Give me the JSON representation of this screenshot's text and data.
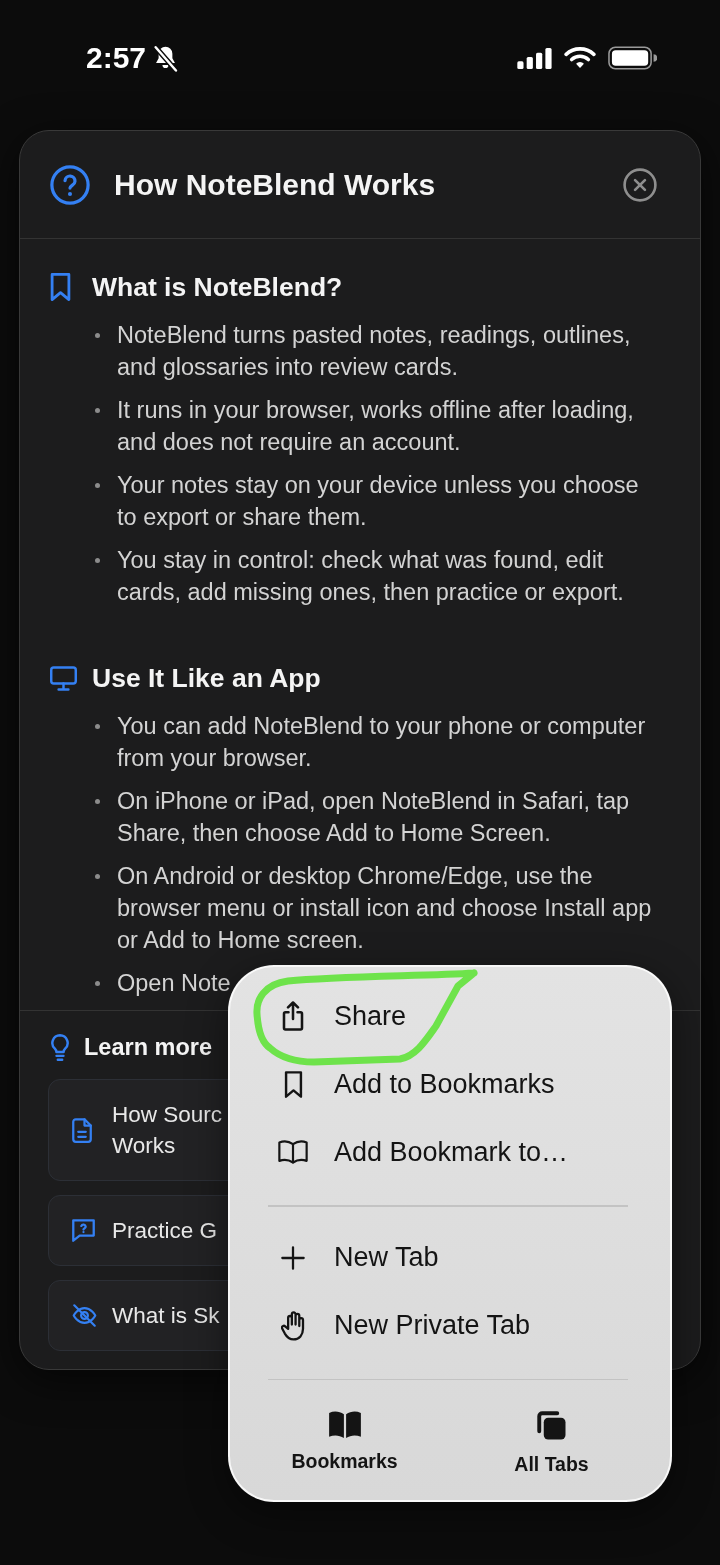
{
  "status_bar": {
    "time": "2:57"
  },
  "dialog": {
    "title": "How NoteBlend Works",
    "sections": [
      {
        "heading": "What is NoteBlend?",
        "bullets": [
          "NoteBlend turns pasted notes, readings, outlines, and glossaries into review cards.",
          "It runs in your browser, works offline after loading, and does not require an account.",
          "Your notes stay on your device unless you choose to export or share them.",
          "You stay in control: check what was found, edit cards, add missing ones, then practice or export."
        ]
      },
      {
        "heading": "Use It Like an App",
        "bullets": [
          "You can add NoteBlend to your phone or computer from your browser.",
          "On iPhone or iPad, open NoteBlend in Safari, tap Share, then choose Add to Home Screen.",
          "On Android or desktop Chrome/Edge, use the browser menu or install icon and choose Install app or Add to Home screen.",
          "Open Note"
        ]
      }
    ],
    "learn_more": {
      "heading": "Learn more",
      "links": [
        {
          "lines": [
            "How Sourc",
            "Works"
          ]
        },
        {
          "lines": [
            "Practice G"
          ]
        },
        {
          "lines": [
            "What is Sk"
          ]
        }
      ]
    }
  },
  "browser_menu": {
    "groups": [
      {
        "items": [
          {
            "label": "Share",
            "circled": true
          },
          {
            "label": "Add to Bookmarks",
            "circled": false
          },
          {
            "label": "Add Bookmark to…",
            "circled": false
          }
        ]
      },
      {
        "items": [
          {
            "label": "New Tab",
            "circled": false
          },
          {
            "label": "New Private Tab",
            "circled": false
          }
        ]
      }
    ],
    "bottom_buttons": [
      {
        "label": "Bookmarks"
      },
      {
        "label": "All Tabs"
      }
    ]
  }
}
